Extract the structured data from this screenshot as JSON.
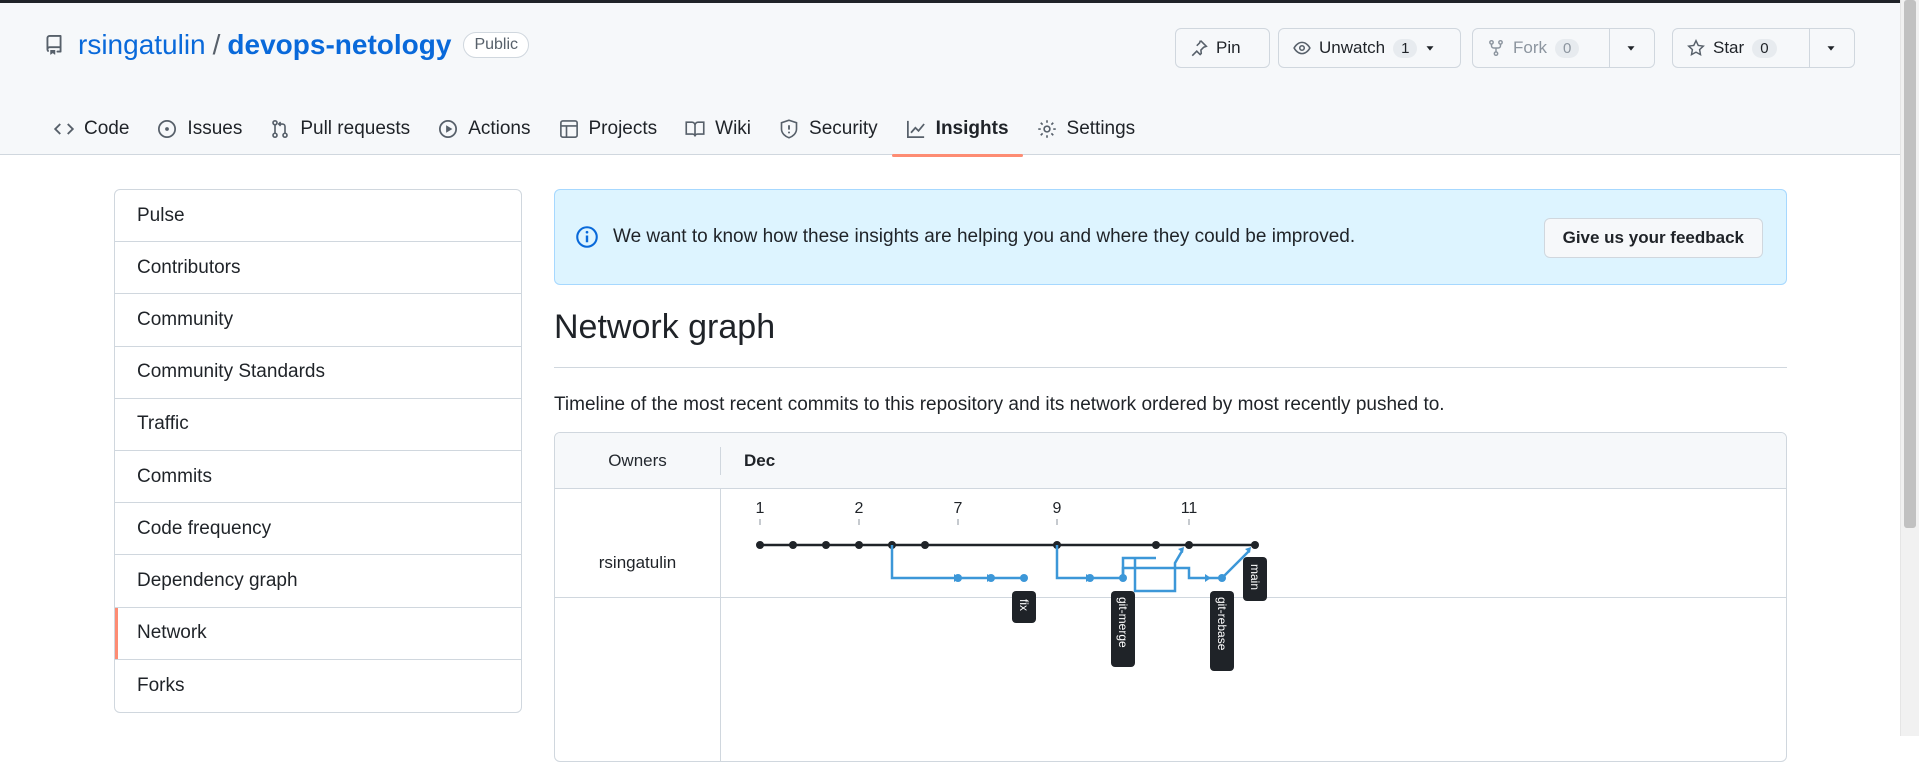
{
  "repo": {
    "owner": "rsingatulin",
    "separator": "/",
    "name": "devops-netology",
    "visibility": "Public"
  },
  "actions": {
    "pin": "Pin",
    "unwatch": "Unwatch",
    "unwatch_count": "1",
    "fork": "Fork",
    "fork_count": "0",
    "star": "Star",
    "star_count": "0"
  },
  "tabs": [
    {
      "label": "Code",
      "icon": "code-icon"
    },
    {
      "label": "Issues",
      "icon": "issue-icon"
    },
    {
      "label": "Pull requests",
      "icon": "pull-request-icon"
    },
    {
      "label": "Actions",
      "icon": "play-icon"
    },
    {
      "label": "Projects",
      "icon": "table-icon"
    },
    {
      "label": "Wiki",
      "icon": "book-icon"
    },
    {
      "label": "Security",
      "icon": "shield-icon"
    },
    {
      "label": "Insights",
      "icon": "graph-icon",
      "active": true
    },
    {
      "label": "Settings",
      "icon": "gear-icon"
    }
  ],
  "sidebar": {
    "items": [
      {
        "label": "Pulse"
      },
      {
        "label": "Contributors"
      },
      {
        "label": "Community"
      },
      {
        "label": "Community Standards"
      },
      {
        "label": "Traffic"
      },
      {
        "label": "Commits"
      },
      {
        "label": "Code frequency"
      },
      {
        "label": "Dependency graph"
      },
      {
        "label": "Network",
        "active": true
      },
      {
        "label": "Forks"
      }
    ]
  },
  "flash": {
    "message": "We want to know how these insights are helping you and where they could be improved.",
    "button": "Give us your feedback"
  },
  "page": {
    "title": "Network graph",
    "description": "Timeline of the most recent commits to this repository and its network ordered by most recently pushed to."
  },
  "network": {
    "owners_label": "Owners",
    "month": "Dec",
    "owner": "rsingatulin",
    "day_labels": [
      "1",
      "2",
      "7",
      "9",
      "11"
    ],
    "branches": [
      "fix",
      "git-merge",
      "git-rebase",
      "main"
    ]
  },
  "colors": {
    "accent": "#fd8c73",
    "link": "#0969da",
    "branch": "#3c97d8",
    "main_line": "#1f2328"
  }
}
